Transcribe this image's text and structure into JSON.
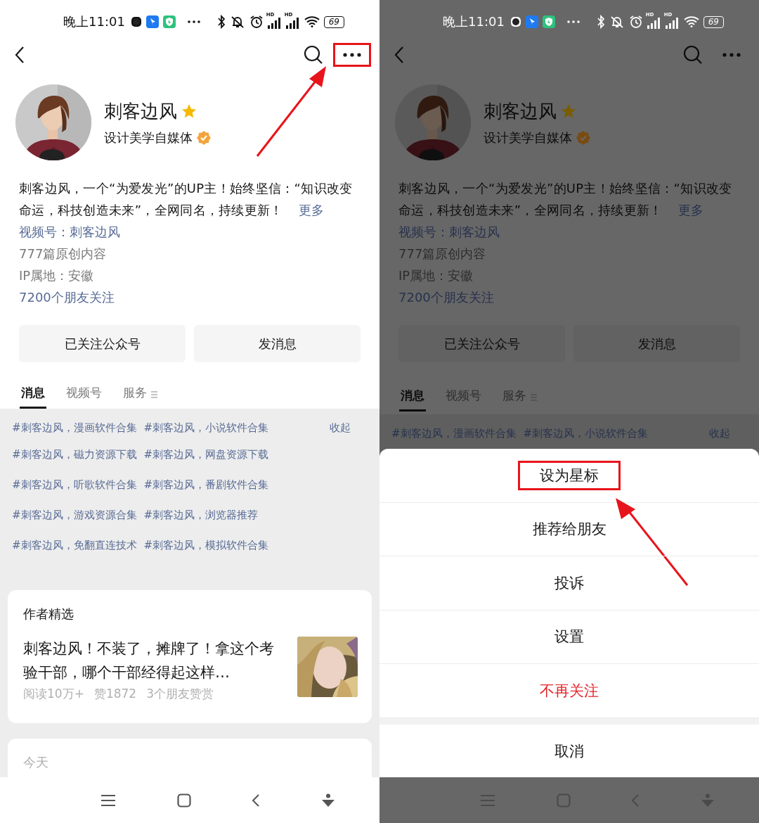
{
  "screens": [
    {
      "dimmed": false,
      "status_bar": {
        "time": "晚上11:01",
        "hd_labels": [
          "HD",
          "HD"
        ],
        "battery": "69"
      },
      "top_bar": {
        "more_highlighted": true
      },
      "profile": {
        "name": "刺客边风",
        "subtitle": "设计美学自媒体",
        "bio": "刺客边风，一个“为爱发光”的UP主！始终坚信：“知识改变命运，科技创造未来”，全网同名，持续更新！",
        "more": "更多",
        "video": "视频号：刺客边风",
        "articles": "777篇原创内容",
        "ip": "IP属地：安徽",
        "followers": "7200个朋友关注"
      },
      "actions": [
        "已关注公众号",
        "发消息"
      ],
      "tabs": [
        {
          "label": "消息",
          "selected": true
        },
        {
          "label": "视频号",
          "selected": false
        },
        {
          "label": "服务",
          "selected": false
        }
      ],
      "tags": [
        [
          "#刺客边风，漫画软件合集",
          "#刺客边风，小说软件合集"
        ],
        [
          "#刺客边风，磁力资源下载",
          "#刺客边风，网盘资源下载"
        ],
        [
          "#刺客边风，听歌软件合集",
          "#刺客边风，番剧软件合集"
        ],
        [
          "#刺客边风，游戏资源合集",
          "#刺客边风，浏览器推荐"
        ],
        [
          "#刺客边风，免翻直连技术",
          "#刺客边风，模拟软件合集"
        ]
      ],
      "collapse": "收起",
      "featured": {
        "heading": "作者精选",
        "title": "刺客边风！不装了，摊牌了！拿这个考验干部，哪个干部经得起这样…",
        "stats": [
          "阅读10万+",
          "赞1872",
          "3个朋友赞赏"
        ]
      },
      "today": "今天"
    },
    {
      "dimmed": true,
      "status_bar": {
        "time": "晚上11:01",
        "hd_labels": [
          "HD",
          "HD"
        ],
        "battery": "69"
      },
      "top_bar": {
        "more_highlighted": false
      },
      "profile": {
        "name": "刺客边风",
        "subtitle": "设计美学自媒体",
        "bio": "刺客边风，一个“为爱发光”的UP主！始终坚信：“知识改变命运，科技创造未来”，全网同名，持续更新！",
        "more": "更多",
        "video": "视频号：刺客边风",
        "articles": "777篇原创内容",
        "ip": "IP属地：安徽",
        "followers": "7200个朋友关注"
      },
      "actions": [
        "已关注公众号",
        "发消息"
      ],
      "tabs": [
        {
          "label": "消息",
          "selected": true
        },
        {
          "label": "视频号",
          "selected": false
        },
        {
          "label": "服务",
          "selected": false
        }
      ],
      "tags": [
        [
          "#刺客边风，漫画软件合集",
          "#刺客边风，小说软件合集"
        ]
      ],
      "collapse": "收起",
      "sheet": {
        "items": [
          {
            "label": "设为星标",
            "kind": "normal",
            "highlighted": true
          },
          {
            "label": "推荐给朋友",
            "kind": "normal",
            "highlighted": false
          },
          {
            "label": "投诉",
            "kind": "normal",
            "highlighted": false
          },
          {
            "label": "设置",
            "kind": "normal",
            "highlighted": false
          },
          {
            "label": "不再关注",
            "kind": "danger",
            "highlighted": false
          }
        ],
        "cancel": "取消"
      }
    }
  ]
}
